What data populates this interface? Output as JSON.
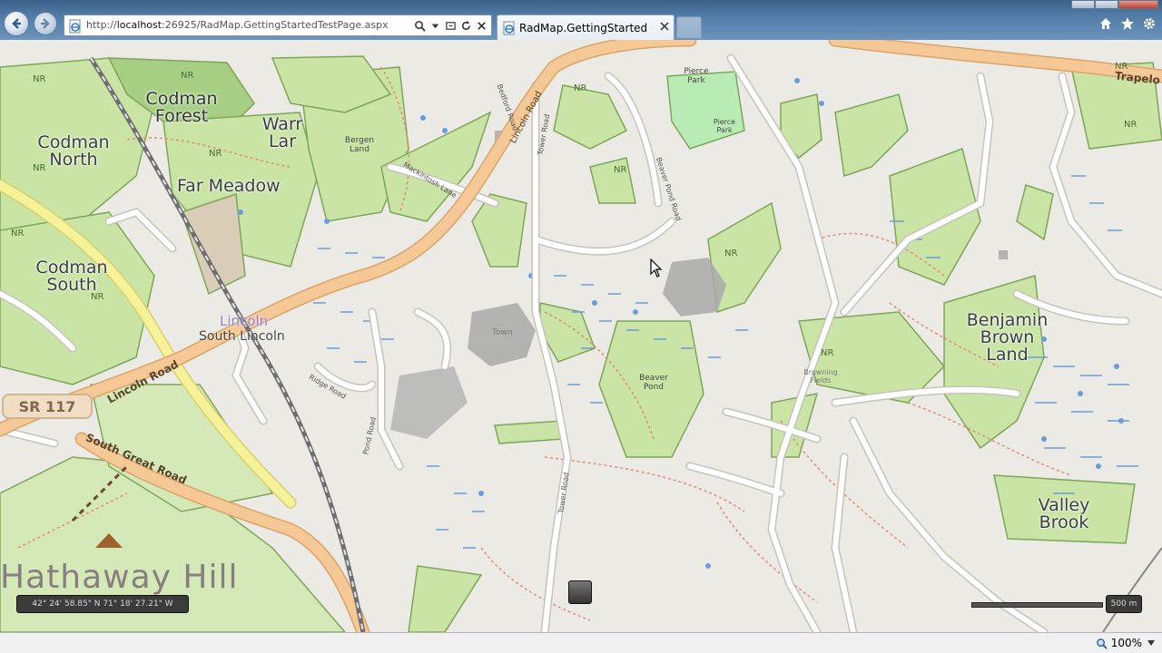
{
  "browser": {
    "address_url_prefix": "http://",
    "address_url_host": "localhost",
    "address_url_rest": ":26925/RadMap.GettingStartedTestPage.aspx",
    "tab_title": "RadMap.GettingStarted",
    "zoom_level": "100%"
  },
  "map": {
    "labels": {
      "codman_north": "Codman North",
      "codman_forest": "Codman Forest",
      "codman_south": "Codman South",
      "warr_lar": "Warr Lar",
      "far_meadow": "Far Meadow",
      "bergen_land": "Bergen Land",
      "lincoln": "Lincoln",
      "south_lincoln": "South Lincoln",
      "pierce_park": "Pierce Park",
      "pierce_park_2": "Pierce Park",
      "town": "Town",
      "beaver_pond": "Beaver Pond",
      "benjamin_brown_land": "Benjamin Brown Land",
      "valley_brook": "Valley Brook",
      "hathaway_hill": "Hathaway Hill",
      "browning_fields": "Browning Fields",
      "trapelo": "Trapelo",
      "sr_117": "SR 117",
      "lincoln_road": "Lincoln Road",
      "lincoln_road_2": "Lincoln Road",
      "south_great_road": "South Great Road",
      "tower_road": "Tower Road",
      "tower_road_2": "Tower Road",
      "beaver_pond_road": "Beaver Pond Road",
      "mackintosh_lane": "Mackintosh Lane",
      "ridge_road": "Ridge Road",
      "pond_road": "Pond Road",
      "bedford_road": "Bedford Road",
      "nr": "NR"
    },
    "coordinates": "42° 24' 58.85\" N 71° 18' 27.21\" W",
    "scale": "500 m"
  },
  "colors": {
    "park": "#c9e4a4",
    "park_border": "#6f9a4a",
    "major_road": "#f4c38e",
    "residential_road": "#ffffff",
    "rail": "#6e6e6e",
    "trunk_yellow": "#f6f29a",
    "footpath": "#e38a7a",
    "wetland": "#6b9cdb",
    "builtup": "#9e9e9e",
    "map_background": "#eceae4"
  }
}
